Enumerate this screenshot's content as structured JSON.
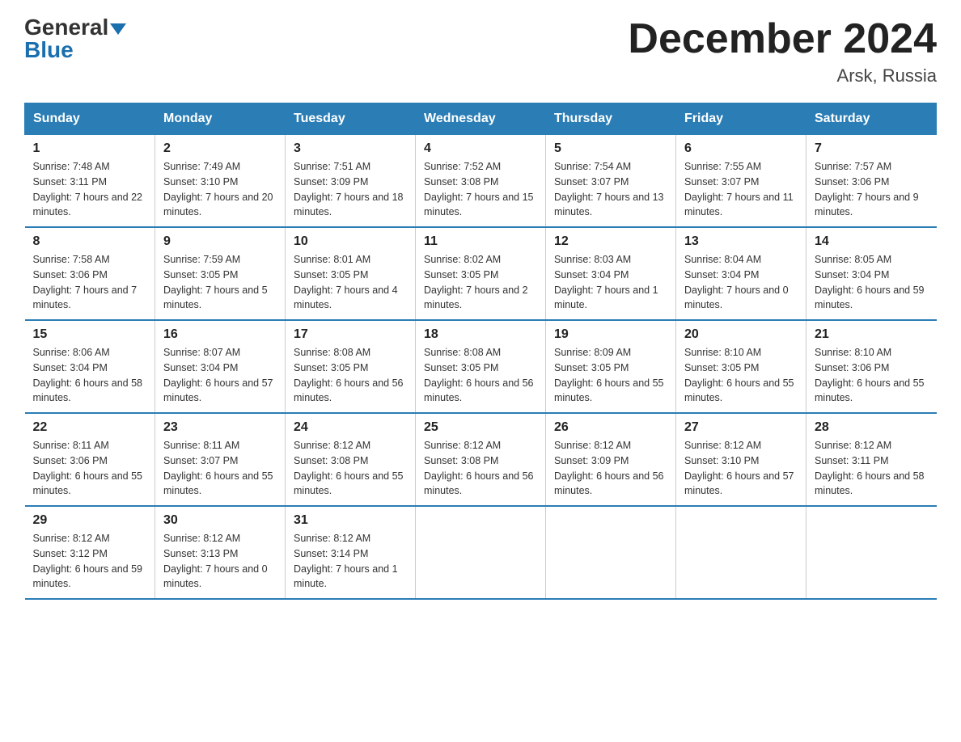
{
  "header": {
    "logo_general": "General",
    "logo_blue": "Blue",
    "title": "December 2024",
    "location": "Arsk, Russia"
  },
  "days_of_week": [
    "Sunday",
    "Monday",
    "Tuesday",
    "Wednesday",
    "Thursday",
    "Friday",
    "Saturday"
  ],
  "weeks": [
    [
      {
        "num": "1",
        "sunrise": "7:48 AM",
        "sunset": "3:11 PM",
        "daylight": "7 hours and 22 minutes."
      },
      {
        "num": "2",
        "sunrise": "7:49 AM",
        "sunset": "3:10 PM",
        "daylight": "7 hours and 20 minutes."
      },
      {
        "num": "3",
        "sunrise": "7:51 AM",
        "sunset": "3:09 PM",
        "daylight": "7 hours and 18 minutes."
      },
      {
        "num": "4",
        "sunrise": "7:52 AM",
        "sunset": "3:08 PM",
        "daylight": "7 hours and 15 minutes."
      },
      {
        "num": "5",
        "sunrise": "7:54 AM",
        "sunset": "3:07 PM",
        "daylight": "7 hours and 13 minutes."
      },
      {
        "num": "6",
        "sunrise": "7:55 AM",
        "sunset": "3:07 PM",
        "daylight": "7 hours and 11 minutes."
      },
      {
        "num": "7",
        "sunrise": "7:57 AM",
        "sunset": "3:06 PM",
        "daylight": "7 hours and 9 minutes."
      }
    ],
    [
      {
        "num": "8",
        "sunrise": "7:58 AM",
        "sunset": "3:06 PM",
        "daylight": "7 hours and 7 minutes."
      },
      {
        "num": "9",
        "sunrise": "7:59 AM",
        "sunset": "3:05 PM",
        "daylight": "7 hours and 5 minutes."
      },
      {
        "num": "10",
        "sunrise": "8:01 AM",
        "sunset": "3:05 PM",
        "daylight": "7 hours and 4 minutes."
      },
      {
        "num": "11",
        "sunrise": "8:02 AM",
        "sunset": "3:05 PM",
        "daylight": "7 hours and 2 minutes."
      },
      {
        "num": "12",
        "sunrise": "8:03 AM",
        "sunset": "3:04 PM",
        "daylight": "7 hours and 1 minute."
      },
      {
        "num": "13",
        "sunrise": "8:04 AM",
        "sunset": "3:04 PM",
        "daylight": "7 hours and 0 minutes."
      },
      {
        "num": "14",
        "sunrise": "8:05 AM",
        "sunset": "3:04 PM",
        "daylight": "6 hours and 59 minutes."
      }
    ],
    [
      {
        "num": "15",
        "sunrise": "8:06 AM",
        "sunset": "3:04 PM",
        "daylight": "6 hours and 58 minutes."
      },
      {
        "num": "16",
        "sunrise": "8:07 AM",
        "sunset": "3:04 PM",
        "daylight": "6 hours and 57 minutes."
      },
      {
        "num": "17",
        "sunrise": "8:08 AM",
        "sunset": "3:05 PM",
        "daylight": "6 hours and 56 minutes."
      },
      {
        "num": "18",
        "sunrise": "8:08 AM",
        "sunset": "3:05 PM",
        "daylight": "6 hours and 56 minutes."
      },
      {
        "num": "19",
        "sunrise": "8:09 AM",
        "sunset": "3:05 PM",
        "daylight": "6 hours and 55 minutes."
      },
      {
        "num": "20",
        "sunrise": "8:10 AM",
        "sunset": "3:05 PM",
        "daylight": "6 hours and 55 minutes."
      },
      {
        "num": "21",
        "sunrise": "8:10 AM",
        "sunset": "3:06 PM",
        "daylight": "6 hours and 55 minutes."
      }
    ],
    [
      {
        "num": "22",
        "sunrise": "8:11 AM",
        "sunset": "3:06 PM",
        "daylight": "6 hours and 55 minutes."
      },
      {
        "num": "23",
        "sunrise": "8:11 AM",
        "sunset": "3:07 PM",
        "daylight": "6 hours and 55 minutes."
      },
      {
        "num": "24",
        "sunrise": "8:12 AM",
        "sunset": "3:08 PM",
        "daylight": "6 hours and 55 minutes."
      },
      {
        "num": "25",
        "sunrise": "8:12 AM",
        "sunset": "3:08 PM",
        "daylight": "6 hours and 56 minutes."
      },
      {
        "num": "26",
        "sunrise": "8:12 AM",
        "sunset": "3:09 PM",
        "daylight": "6 hours and 56 minutes."
      },
      {
        "num": "27",
        "sunrise": "8:12 AM",
        "sunset": "3:10 PM",
        "daylight": "6 hours and 57 minutes."
      },
      {
        "num": "28",
        "sunrise": "8:12 AM",
        "sunset": "3:11 PM",
        "daylight": "6 hours and 58 minutes."
      }
    ],
    [
      {
        "num": "29",
        "sunrise": "8:12 AM",
        "sunset": "3:12 PM",
        "daylight": "6 hours and 59 minutes."
      },
      {
        "num": "30",
        "sunrise": "8:12 AM",
        "sunset": "3:13 PM",
        "daylight": "7 hours and 0 minutes."
      },
      {
        "num": "31",
        "sunrise": "8:12 AM",
        "sunset": "3:14 PM",
        "daylight": "7 hours and 1 minute."
      },
      null,
      null,
      null,
      null
    ]
  ]
}
